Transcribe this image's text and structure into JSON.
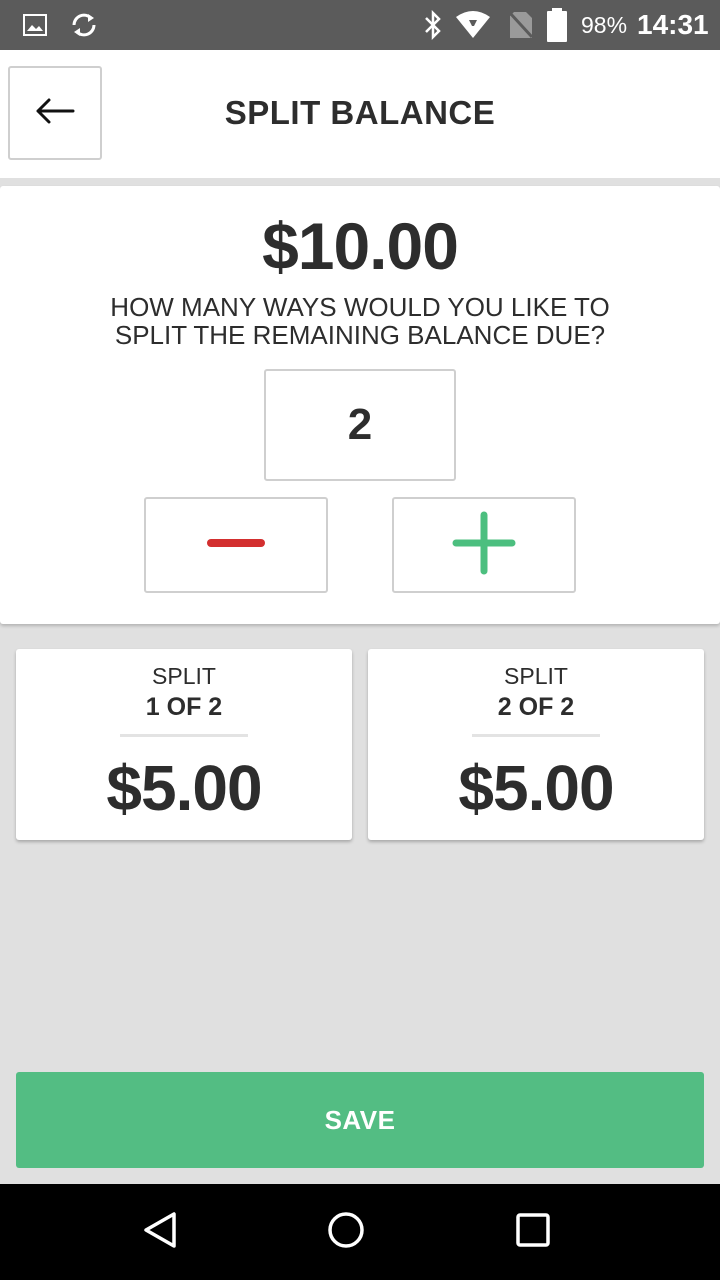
{
  "status_bar": {
    "battery": "98%",
    "time": "14:31",
    "icons": [
      "image-icon",
      "sync-icon",
      "bluetooth-icon",
      "wifi-icon",
      "no-sim-icon",
      "battery-icon"
    ]
  },
  "header": {
    "title": "SPLIT BALANCE",
    "back_icon": "arrow-left-icon"
  },
  "balance": {
    "total": "$10.00",
    "question_line1": "HOW MANY WAYS WOULD YOU LIKE TO",
    "question_line2": "SPLIT THE REMAINING BALANCE DUE?",
    "split_count": "2",
    "minus_icon": "minus-icon",
    "plus_icon": "plus-icon"
  },
  "splits": [
    {
      "label": "SPLIT",
      "position": "1 OF 2",
      "amount": "$5.00"
    },
    {
      "label": "SPLIT",
      "position": "2 OF 2",
      "amount": "$5.00"
    }
  ],
  "save_label": "SAVE",
  "colors": {
    "accent_green": "#53bd83",
    "minus_red": "#d32f2f",
    "plus_green": "#4cbf7f",
    "text_dark": "#2d2d2d"
  },
  "nav_bar": {
    "icons": [
      "back-triangle-icon",
      "home-circle-icon",
      "recents-square-icon"
    ]
  }
}
